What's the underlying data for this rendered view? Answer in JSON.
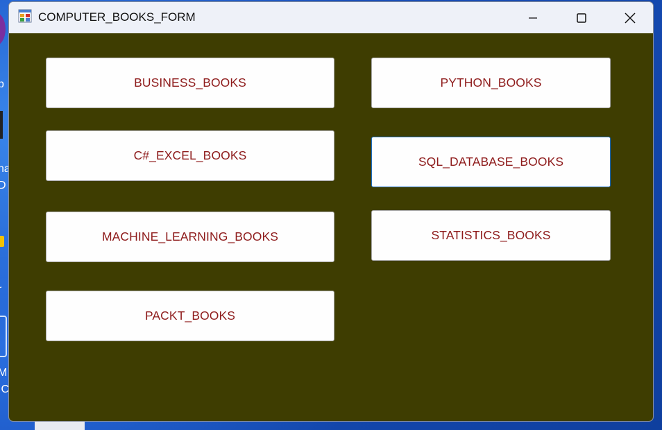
{
  "window": {
    "title": "COMPUTER_BOOKS_FORM"
  },
  "buttons": {
    "business": "BUSINESS_BOOKS",
    "python": "PYTHON_BOOKS",
    "csharp_excel": "C#_EXCEL_BOOKS",
    "sql_database": "SQL_DATABASE_BOOKS",
    "machine_learning": "MACHINE_LEARNING_BOOKS",
    "statistics": "STATISTICS_BOOKS",
    "packt": "PACKT_BOOKS"
  },
  "desktop": {
    "fragments": [
      "p",
      "na",
      "D",
      "r",
      "M",
      ".C"
    ]
  },
  "colors": {
    "client_background": "#3e3d01",
    "button_text": "#8e1b1b",
    "focus_border": "#1a6fc8"
  }
}
